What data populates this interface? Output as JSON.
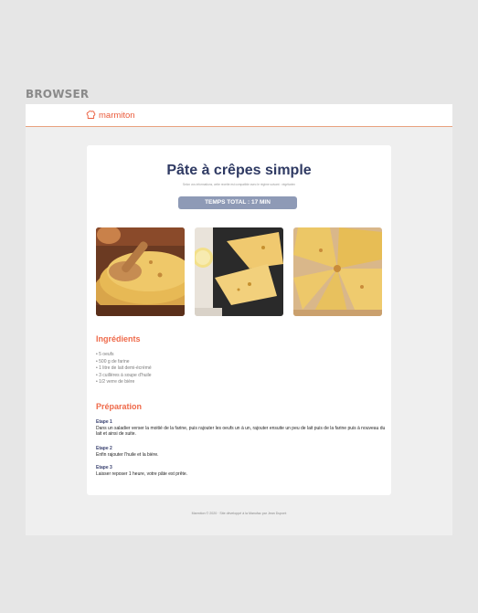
{
  "frame": {
    "label": "BROWSER"
  },
  "header": {
    "logo_text": "marmiton",
    "logo_icon": "chef-hat-icon"
  },
  "recipe": {
    "title": "Pâte à crêpes simple",
    "subtitle": "Selon vos informations, cette recette est compatible avec le régime suivant : végétarien",
    "total_time": "TEMPS TOTAL : 17 MIN",
    "images": [
      "crepes-stack-with-wooden-spoon",
      "folded-crepes-with-lemon",
      "folded-crepes-on-board"
    ]
  },
  "ingredients": {
    "heading": "Ingrédients",
    "items": [
      "• 5 oeufs",
      "• 500 g de farine",
      "• 1 litre de lait demi-écrémé",
      "• 3 cuillères à soupe d'huile",
      "• 1/2 verre de bière"
    ]
  },
  "preparation": {
    "heading": "Préparation",
    "steps": [
      {
        "title": "Etape 1",
        "text": "Dans un saladier verser la moitié de la farine, puis rajouter les oeufs un à un, rajouter ensuite un peu de lait puis de la farine puis à nouveau du lait et ainsi de suite."
      },
      {
        "title": "Etape 2",
        "text": "Enfin rajouter l'huile et la bière."
      },
      {
        "title": "Etape 3",
        "text": "Laisser reposer 1 heure, votre pâte est prête."
      }
    ]
  },
  "footer": {
    "text": "Marmiton © 2020 · Site développé à la Manufac par Jean Dupont"
  },
  "colors": {
    "accent": "#ea5b3b",
    "title": "#2f3a63",
    "button": "#8e9ab6",
    "step_title": "#3c4472"
  }
}
